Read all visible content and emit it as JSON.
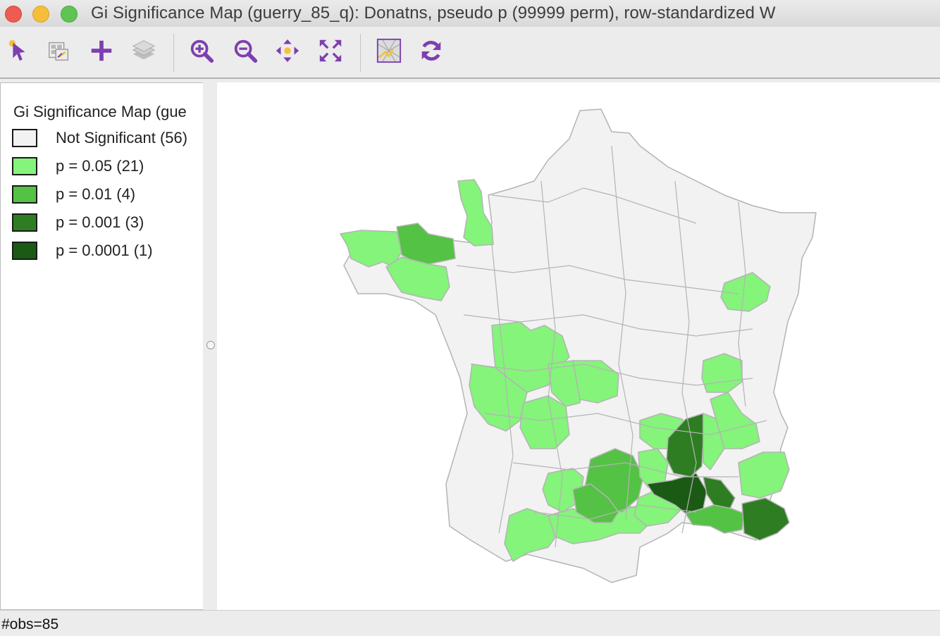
{
  "window": {
    "title": "Gi Significance Map (guerry_85_q): Donatns, pseudo p (99999 perm), row-standardized W"
  },
  "toolbar": {
    "tools": [
      {
        "name": "select-tool",
        "icon": "pointer-icon"
      },
      {
        "name": "selection-table-tool",
        "icon": "table-select-icon"
      },
      {
        "name": "add-tool",
        "icon": "plus-icon"
      },
      {
        "name": "layers-tool",
        "icon": "layers-icon"
      },
      {
        "name": "zoom-in-tool",
        "icon": "zoom-in-icon"
      },
      {
        "name": "zoom-out-tool",
        "icon": "zoom-out-icon"
      },
      {
        "name": "pan-tool",
        "icon": "pan-icon"
      },
      {
        "name": "full-extent-tool",
        "icon": "full-extent-icon"
      },
      {
        "name": "basemap-tool",
        "icon": "basemap-icon"
      },
      {
        "name": "refresh-tool",
        "icon": "refresh-icon"
      }
    ],
    "accent_color": "#7d3fb0"
  },
  "legend": {
    "title": "Gi Significance Map (gue",
    "items": [
      {
        "label": "Not Significant (56)",
        "color": "#f2f2f2"
      },
      {
        "label": "p = 0.05 (21)",
        "color": "#84f47a"
      },
      {
        "label": "p = 0.01 (4)",
        "color": "#54c244"
      },
      {
        "label": "p = 0.001 (3)",
        "color": "#2f7d23"
      },
      {
        "label": "p = 0.0001 (1)",
        "color": "#1b5a14"
      }
    ]
  },
  "map": {
    "region_border_color": "#b4b4b4"
  },
  "status": {
    "text": "#obs=85"
  }
}
